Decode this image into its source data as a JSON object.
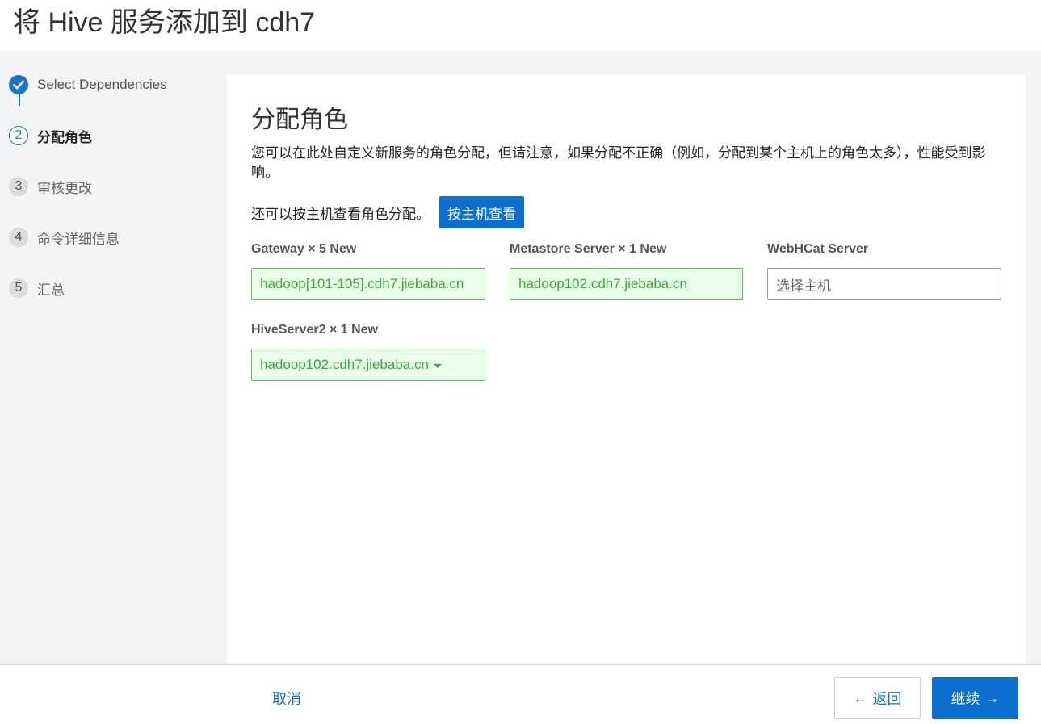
{
  "header": {
    "title": "将 Hive 服务添加到 cdh7"
  },
  "steps": [
    {
      "marker": "",
      "label": "Select Dependencies",
      "state": "done"
    },
    {
      "marker": "2",
      "label": "分配角色",
      "state": "current"
    },
    {
      "marker": "3",
      "label": "审核更改",
      "state": "pending"
    },
    {
      "marker": "4",
      "label": "命令详细信息",
      "state": "pending"
    },
    {
      "marker": "5",
      "label": "汇总",
      "state": "pending"
    }
  ],
  "main": {
    "title": "分配角色",
    "description": "您可以在此处自定义新服务的角色分配，但请注意，如果分配不正确（例如，分配到某个主机上的角色太多），性能受到影响。",
    "view_by_host_text": "还可以按主机查看角色分配。",
    "view_by_host_button": "按主机查看",
    "roles": [
      {
        "label": "Gateway × 5 New",
        "value": "hadoop[101-105].cdh7.jiebaba.cn",
        "placeholder": ""
      },
      {
        "label": "Metastore Server × 1 New",
        "value": "hadoop102.cdh7.jiebaba.cn",
        "placeholder": ""
      },
      {
        "label": "WebHCat Server",
        "value": "",
        "placeholder": "选择主机"
      },
      {
        "label": "HiveServer2 × 1 New",
        "value": "hadoop102.cdh7.jiebaba.cn",
        "placeholder": ""
      }
    ]
  },
  "footer": {
    "cancel": "取消",
    "back": "返回",
    "continue": "继续"
  },
  "colors": {
    "accent": "#0a6fcf",
    "assigned_bg": "#eaffea",
    "assigned_border": "#5cc15c",
    "assigned_text": "#3aa83a"
  },
  "icons": {
    "done_step": "check-icon",
    "dropdown": "caret-down-icon",
    "back": "arrow-left-icon",
    "continue": "arrow-right-icon"
  }
}
